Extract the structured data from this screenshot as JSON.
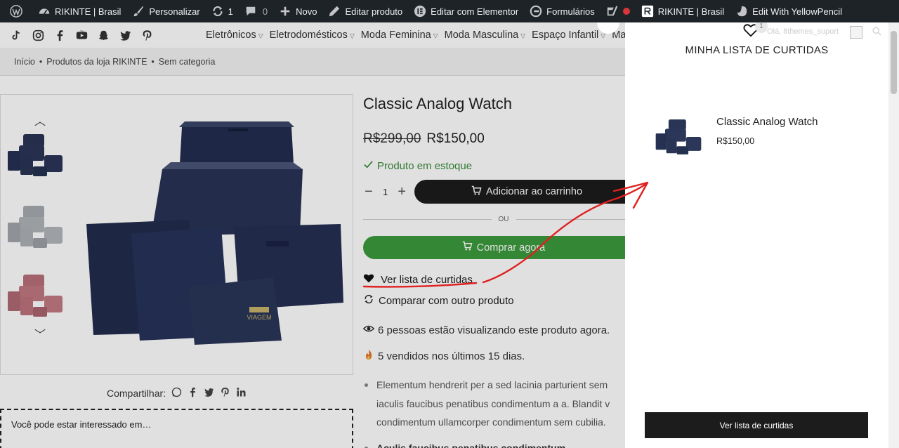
{
  "adminbar": {
    "site_name": "RIKINTE | Brasil",
    "customize": "Personalizar",
    "updates_count": "1",
    "comments_count": "0",
    "new": "Novo",
    "edit_product": "Editar produto",
    "edit_elementor": "Editar com Elementor",
    "forms": "Formulários",
    "site_name_2": "RIKINTE | Brasil",
    "yellowpencil": "Edit With YellowPencil"
  },
  "social_icons": [
    "tiktok-icon",
    "instagram-icon",
    "facebook-icon",
    "youtube-icon",
    "snapchat-icon",
    "twitter-icon",
    "pinterest-icon"
  ],
  "menu": {
    "items": [
      "Eletrônicos",
      "Eletrodomésticos",
      "Moda Feminina",
      "Moda Masculina",
      "Espaço Infantil",
      "Mamã"
    ]
  },
  "breadcrumb": {
    "home": "Início",
    "sep1": "•",
    "shop": "Produtos da loja RIKINTE",
    "sep2": "•",
    "category": "Sem categoria"
  },
  "product": {
    "title": "Classic Analog Watch",
    "old_price": "R$299,00",
    "price": "R$150,00",
    "stock": "Produto em estoque",
    "quantity": "1",
    "add_to_cart": "Adicionar ao carrinho",
    "or": "OU",
    "buy_now": "Comprar agora",
    "wishlist_link": "Ver lista de curtidas",
    "compare": "Comparar com outro produto",
    "viewing": "6 pessoas estão visualizando este produto agora.",
    "sold": "5 vendidos nos últimos 15 dias.",
    "desc": [
      "Elementum hendrerit per a sed lacinia parturient sem",
      "iaculis faucibus penatibus condimentum a a. Blandit v",
      "condimentum ullamcorper condimentum sem cubilia."
    ],
    "desc_bold": "Aculis faucibus penatibus condimentum."
  },
  "share": {
    "label": "Compartilhar:"
  },
  "related": {
    "title": "Você pode estar interessado em…"
  },
  "wishlist_panel": {
    "greeting": "Olá, 8themes_suport",
    "count": "1",
    "title": "MINHA LISTA DE CURTIDAS",
    "items": [
      {
        "name": "Classic Analog Watch",
        "price": "R$150,00"
      }
    ],
    "button": "Ver lista de curtidas"
  },
  "colors": {
    "adminbar_bg": "#1d2327",
    "button_dark": "#1c1c1c",
    "buy_green": "#3c9a3c",
    "stock_green": "#3a8a3a",
    "annotation_red": "#e02020"
  }
}
